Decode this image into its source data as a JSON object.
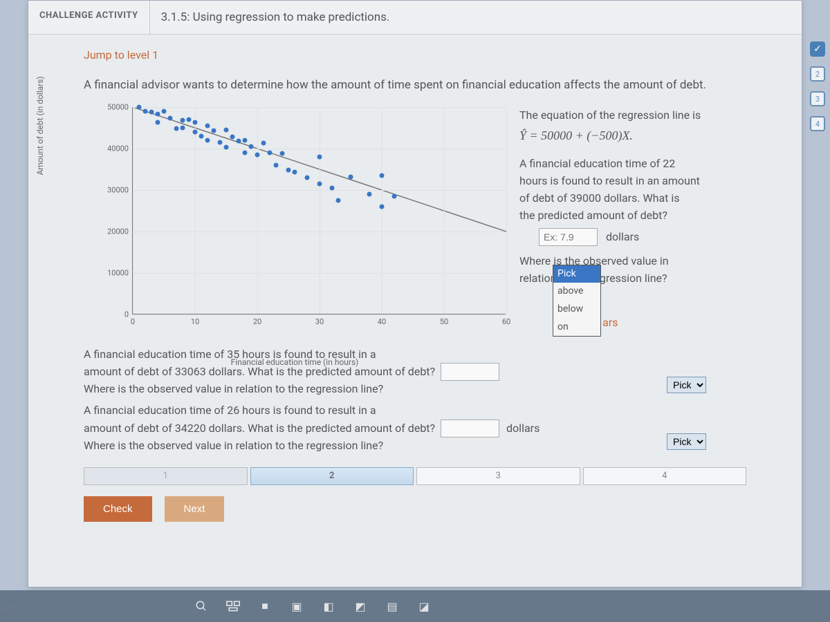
{
  "header": {
    "challenge_label": "CHALLENGE ACTIVITY",
    "title": "3.1.5: Using regression to make predictions."
  },
  "jump_link": "Jump to level 1",
  "intro": "A financial advisor wants to determine how the amount of time spent on financial education affects the amount of debt.",
  "right": {
    "eq_intro": "The equation of the regression line is",
    "eq": "Ŷ = 50000 + (−500)X.",
    "q1_line1": "A financial education time of 22",
    "q1_line2": "hours is found to result in an amount",
    "q1_line3": "of debt of 39000 dollars. What is",
    "q1_line4": "the predicted amount of debt?",
    "input1_placeholder": "Ex: 7.9",
    "dollars": "dollars",
    "q1b_line1": "Where is the observed value in",
    "q1b_line2": "relation to the regression line?",
    "ars_fragment": "ars"
  },
  "pick_options": [
    "Pick",
    "above",
    "below",
    "on"
  ],
  "below": {
    "q2_line1": "A financial education time of 35 hours is found to result in a",
    "q2_line2": "amount of debt of 33063 dollars. What is the predicted amount of debt?",
    "q2_line3": "Where is the observed value in relation to the regression line?",
    "q3_line1": "A financial education time of 26 hours is found to result in a",
    "q3_line2": "amount of debt of 34220 dollars. What is the predicted amount of debt?",
    "q3_line3": "Where is the observed value in relation to the regression line?",
    "pick_label": "Pick",
    "dollars": "dollars"
  },
  "progress": {
    "cells": [
      "1",
      "2",
      "3",
      "4"
    ],
    "active_index": 1,
    "done_index": 0
  },
  "buttons": {
    "check": "Check",
    "next": "Next"
  },
  "steps": [
    "✓",
    "2",
    "3",
    "4"
  ],
  "search_label": "arch",
  "chart_data": {
    "type": "scatter",
    "title": "",
    "xlabel": "Financial education time (in hours)",
    "ylabel": "Amount of debt (in dollars)",
    "xlim": [
      0,
      60
    ],
    "ylim": [
      0,
      50000
    ],
    "xticks": [
      0,
      10,
      20,
      30,
      40,
      50,
      60
    ],
    "yticks": [
      0,
      10000,
      20000,
      30000,
      40000,
      50000
    ],
    "regression": {
      "intercept": 50000,
      "slope": -500
    },
    "points_xy": [
      [
        1,
        50000
      ],
      [
        2,
        49000
      ],
      [
        3,
        48800
      ],
      [
        4,
        48200
      ],
      [
        4,
        46200
      ],
      [
        5,
        49000
      ],
      [
        6,
        47200
      ],
      [
        7,
        44800
      ],
      [
        8,
        46800
      ],
      [
        8,
        45000
      ],
      [
        9,
        47000
      ],
      [
        10,
        44000
      ],
      [
        10,
        46200
      ],
      [
        11,
        43000
      ],
      [
        12,
        45500
      ],
      [
        12,
        42000
      ],
      [
        13,
        44200
      ],
      [
        14,
        41500
      ],
      [
        15,
        44500
      ],
      [
        15,
        40200
      ],
      [
        16,
        42800
      ],
      [
        17,
        41800
      ],
      [
        18,
        39000
      ],
      [
        18,
        42000
      ],
      [
        19,
        40500
      ],
      [
        20,
        38500
      ],
      [
        21,
        41200
      ],
      [
        22,
        39000
      ],
      [
        23,
        36000
      ],
      [
        24,
        38800
      ],
      [
        25,
        34800
      ],
      [
        26,
        34220
      ],
      [
        28,
        33000
      ],
      [
        30,
        31500
      ],
      [
        30,
        38000
      ],
      [
        32,
        30500
      ],
      [
        33,
        27500
      ],
      [
        35,
        33063
      ],
      [
        38,
        29000
      ],
      [
        40,
        26000
      ],
      [
        40,
        33500
      ],
      [
        42,
        28500
      ]
    ]
  }
}
